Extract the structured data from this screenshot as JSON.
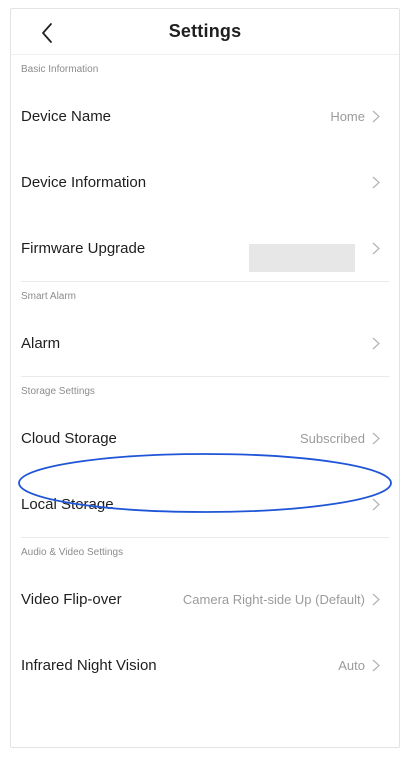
{
  "header": {
    "title": "Settings",
    "back_icon": "chevron-left-icon"
  },
  "sections": [
    {
      "label": "Basic Information",
      "items": [
        {
          "label": "Device Name",
          "value": "Home"
        },
        {
          "label": "Device Information",
          "value": ""
        },
        {
          "label": "Firmware Upgrade",
          "value": ""
        }
      ]
    },
    {
      "label": "Smart Alarm",
      "items": [
        {
          "label": "Alarm",
          "value": ""
        }
      ]
    },
    {
      "label": "Storage Settings",
      "items": [
        {
          "label": "Cloud Storage",
          "value": "Subscribed"
        },
        {
          "label": "Local Storage",
          "value": ""
        }
      ]
    },
    {
      "label": "Audio & Video Settings",
      "items": [
        {
          "label": "Video Flip-over",
          "value": "Camera Right-side Up (Default)"
        },
        {
          "label": "Infrared Night Vision",
          "value": "Auto"
        }
      ]
    }
  ],
  "colors": {
    "annotation": "#1f55d6",
    "secondary_text": "#9b9b9b"
  }
}
